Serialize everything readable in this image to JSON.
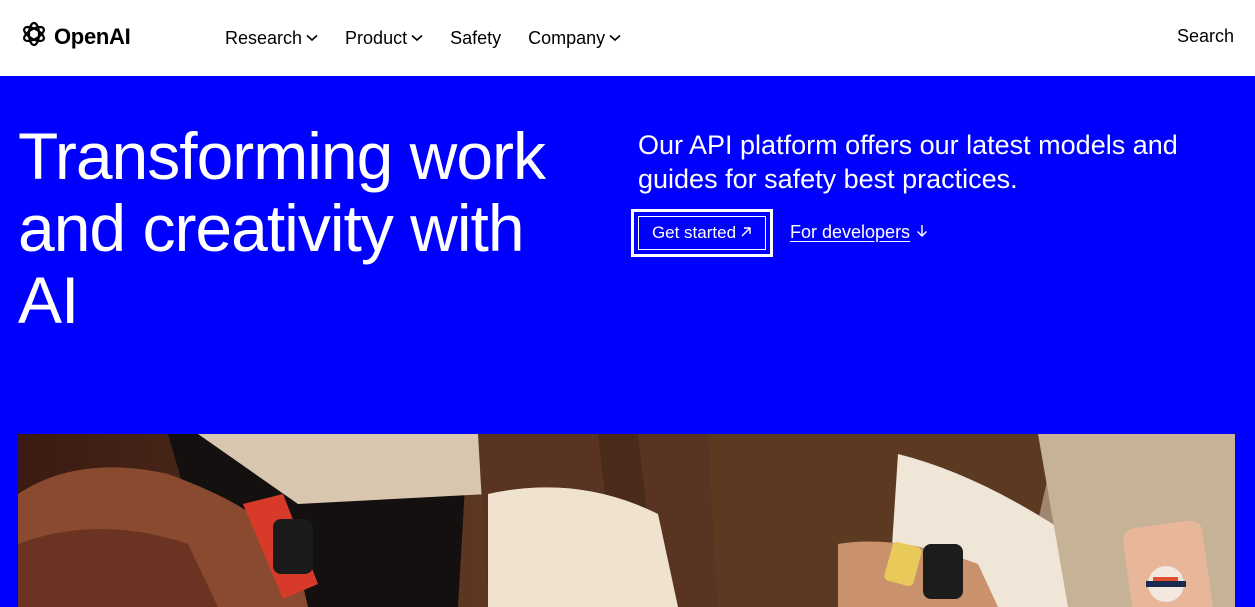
{
  "brand": {
    "name": "OpenAI",
    "logo_icon": "openai-knot-icon"
  },
  "nav": {
    "items": [
      {
        "label": "Research",
        "has_dropdown": true
      },
      {
        "label": "Product",
        "has_dropdown": true
      },
      {
        "label": "Safety",
        "has_dropdown": false
      },
      {
        "label": "Company",
        "has_dropdown": true
      }
    ],
    "search_label": "Search"
  },
  "hero": {
    "title": "Transforming work and creativity with AI",
    "description": "Our API platform offers our latest models and guides for safety best practices.",
    "primary_cta": "Get started",
    "primary_cta_icon": "arrow-up-right-icon",
    "secondary_cta": "For developers",
    "secondary_cta_icon": "arrow-down-icon"
  },
  "colors": {
    "hero_background": "#0000FF",
    "header_background": "#FFFFFF",
    "text_on_hero": "#FFFFFF"
  }
}
